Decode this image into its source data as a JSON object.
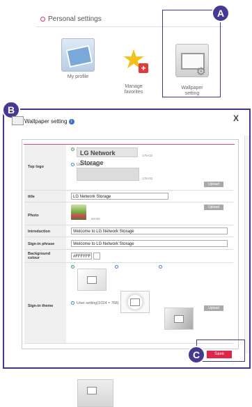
{
  "personal": {
    "title": "Personal settings",
    "items": [
      {
        "label": "My profile",
        "icon": "profile-card-icon"
      },
      {
        "label": "Manage\nfavorites",
        "icon": "star-plus-icon"
      },
      {
        "label": "Wallpaper\nsetting",
        "icon": "wallpaper-gear-icon"
      }
    ]
  },
  "callouts": {
    "a": "A",
    "b": "B",
    "c": "C"
  },
  "dialog": {
    "title": "Wallpaper setting",
    "close": "X",
    "rows": {
      "top_logo": {
        "label": "Top logo",
        "logo_text": "LG Network Storage",
        "size1": "176×32",
        "user_setting": "User setting",
        "size2": "176×32",
        "upload": "Upload"
      },
      "title": {
        "label": "title",
        "value": "LG Network Storage"
      },
      "photo": {
        "label": "Photo",
        "size": "50×50",
        "upload": "Upload"
      },
      "introduction": {
        "label": "Introduction",
        "value": "Welcome to LG Network Storage"
      },
      "signin_phrase": {
        "label": "Sign-in phrase",
        "value": "Welcome to LG Network Storage"
      },
      "background": {
        "label": "Background colour",
        "value": "#FFFFFF"
      },
      "signin_theme": {
        "label": "Sign-in theme",
        "user_setting": "User setting(1024 × 768)",
        "upload": "Upload"
      }
    },
    "save": "Save"
  },
  "colors": {
    "accent": "#43348e",
    "save": "#e0244a",
    "rule": "#d94b6c"
  }
}
